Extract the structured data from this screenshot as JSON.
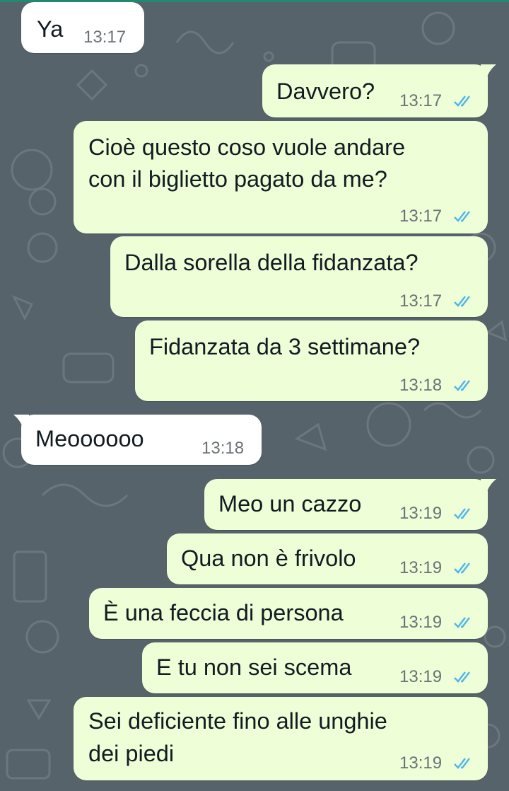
{
  "colors": {
    "background": "#56636a",
    "incoming_bubble": "#ffffff",
    "outgoing_bubble": "#eefed7",
    "read_ticks": "#4fb6ec",
    "time_text": "#6b7276"
  },
  "messages": [
    {
      "direction": "incoming",
      "lines": [
        "Ya"
      ],
      "time": "13:17"
    },
    {
      "direction": "outgoing",
      "lines": [
        "Davvero?"
      ],
      "time": "13:17",
      "status_icon": "double-check-read-icon"
    },
    {
      "direction": "outgoing",
      "lines": [
        "Cioè questo coso vuole andare",
        "con il biglietto pagato da me?"
      ],
      "time": "13:17",
      "status_icon": "double-check-read-icon"
    },
    {
      "direction": "outgoing",
      "lines": [
        "Dalla sorella della fidanzata?"
      ],
      "time": "13:17",
      "status_icon": "double-check-read-icon"
    },
    {
      "direction": "outgoing",
      "lines": [
        "Fidanzata da 3 settimane?"
      ],
      "time": "13:18",
      "status_icon": "double-check-read-icon"
    },
    {
      "direction": "incoming",
      "lines": [
        "Meoooooo"
      ],
      "time": "13:18"
    },
    {
      "direction": "outgoing",
      "lines": [
        "Meo un cazzo"
      ],
      "time": "13:19",
      "status_icon": "double-check-read-icon"
    },
    {
      "direction": "outgoing",
      "lines": [
        "Qua non è frivolo"
      ],
      "time": "13:19",
      "status_icon": "double-check-read-icon"
    },
    {
      "direction": "outgoing",
      "lines": [
        "È una feccia di persona"
      ],
      "time": "13:19",
      "status_icon": "double-check-read-icon"
    },
    {
      "direction": "outgoing",
      "lines": [
        "E tu non sei scema"
      ],
      "time": "13:19",
      "status_icon": "double-check-read-icon"
    },
    {
      "direction": "outgoing",
      "lines": [
        "Sei deficiente fino alle unghie",
        "dei piedi"
      ],
      "time": "13:19",
      "status_icon": "double-check-read-icon"
    }
  ]
}
